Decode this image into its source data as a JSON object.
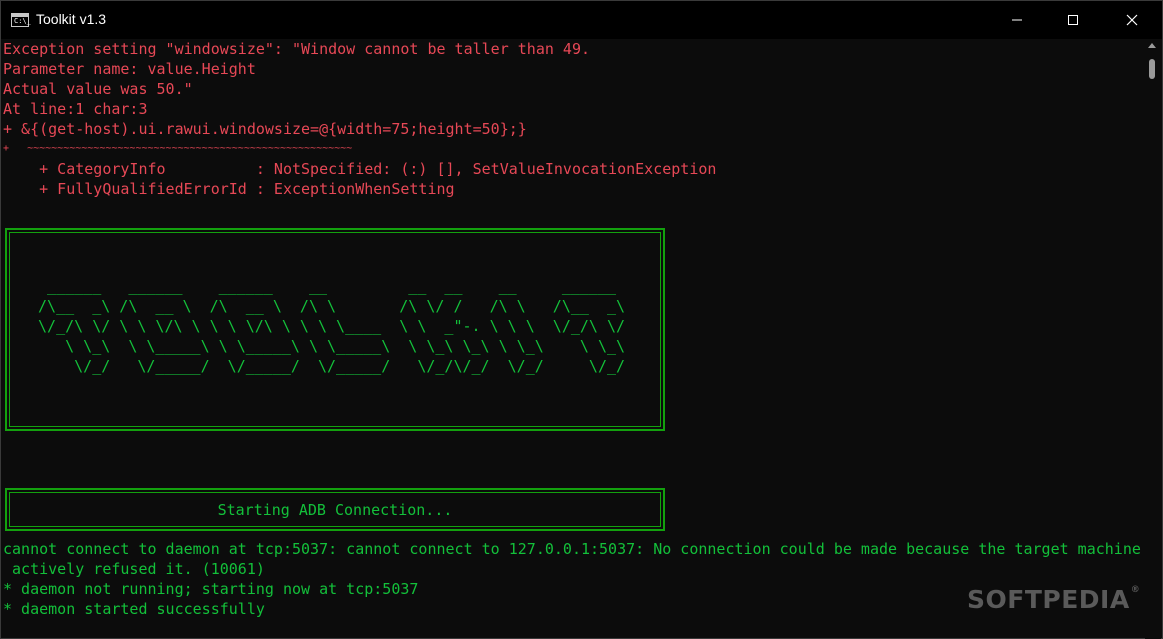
{
  "window": {
    "title": "Toolkit v1.3",
    "app_icon_label": "C:\\_",
    "controls": [
      "minimize-icon",
      "maximize-icon",
      "close-icon"
    ]
  },
  "console": {
    "error_lines": [
      "Exception setting \"windowsize\": \"Window cannot be taller than 49.",
      "Parameter name: value.Height",
      "Actual value was 50.\"",
      "At line:1 char:3",
      "+ &{(get-host).ui.rawui.windowsize=@{width=75;height=50};}",
      "+   ~~~~~~~~~~~~~~~~~~~~~~~~~~~~~~~~~~~~~~~~~~~~~~~~~~~~~~",
      "    + CategoryInfo          : NotSpecified: (:) [], SetValueInvocationException",
      "    + FullyQualifiedErrorId : ExceptionWhenSetting"
    ],
    "logo_ascii": "  ______   ______    ______    __         __  __    __     ______\n /\\__  _\\ /\\  __ \\  /\\  __ \\  /\\ \\       /\\ \\/ /   /\\ \\   /\\__  _\\\n \\/_/\\ \\/ \\ \\ \\/\\ \\ \\ \\ \\/\\ \\ \\ \\ \\____  \\ \\  _\"-. \\ \\ \\  \\/_/\\ \\/\n    \\ \\_\\  \\ \\_____\\ \\ \\_____\\ \\ \\_____\\  \\ \\_\\ \\_\\ \\ \\_\\    \\ \\_\\\n     \\/_/   \\/_____/  \\/_____/  \\/_____/   \\/_/\\/_/  \\/_/     \\/_/",
    "adb_status": "Starting ADB Connection...",
    "output_lines": [
      "cannot connect to daemon at tcp:5037: cannot connect to 127.0.0.1:5037: No connection could be made because the target machine",
      " actively refused it. (10061)",
      "* daemon not running; starting now at tcp:5037",
      "* daemon started successfully"
    ]
  },
  "colors": {
    "background": "#0c0c0c",
    "error_text": "#e74856",
    "success_text": "#13c03a",
    "box_border": "#13a10e"
  },
  "watermark": {
    "text": "SOFTPEDIA",
    "mark": "®"
  }
}
